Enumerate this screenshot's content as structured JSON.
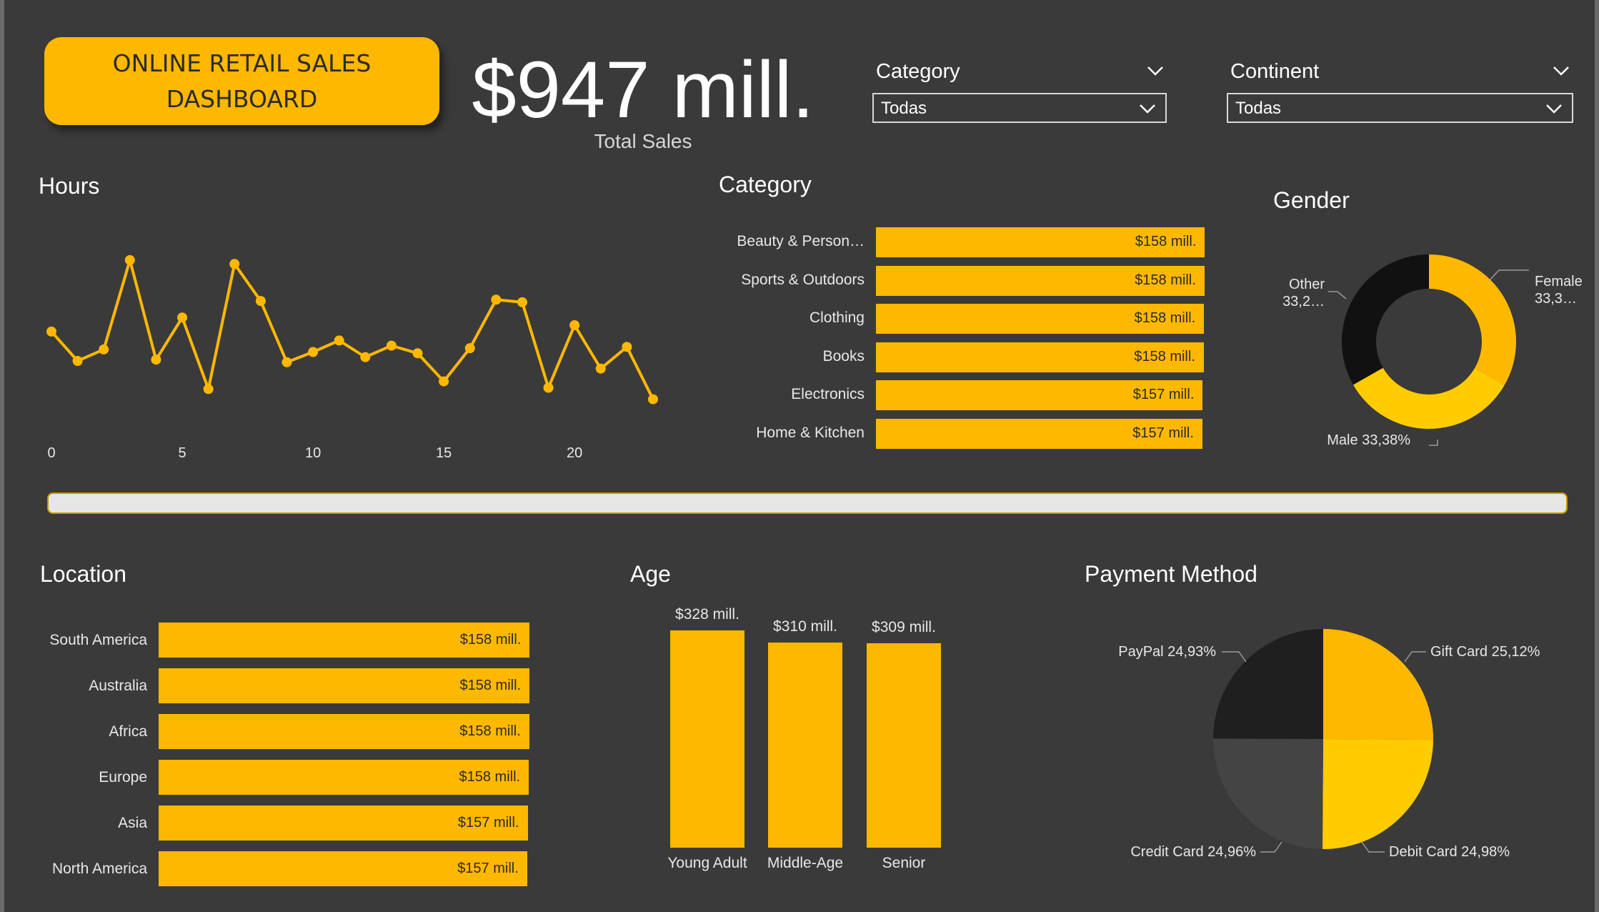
{
  "header": {
    "title": "ONLINE RETAIL SALES\nDASHBOARD",
    "kpi_value": "$947 mill.",
    "kpi_label": "Total Sales"
  },
  "filters": {
    "category": {
      "title": "Category",
      "selected": "Todas"
    },
    "continent": {
      "title": "Continent",
      "selected": "Todas"
    }
  },
  "colors": {
    "background": "#3a3a3a",
    "accent": "#ffb800",
    "accent_light": "#ffcc00",
    "dark_slice": "#1f1f1f",
    "mid_slice": "#444444",
    "scrollbar": "#e6e6e6"
  },
  "icons": {
    "dropdown": "chevron-down-icon"
  },
  "chart_data": [
    {
      "id": "hours",
      "type": "line",
      "title": "Hours",
      "x": [
        0,
        1,
        2,
        3,
        4,
        5,
        6,
        7,
        8,
        9,
        10,
        11,
        12,
        13,
        14,
        15,
        16,
        17,
        18,
        19,
        20,
        21,
        22,
        23
      ],
      "values": [
        41.5,
        39.2,
        40.1,
        47.1,
        39.3,
        42.6,
        37.0,
        46.8,
        43.9,
        39.1,
        39.9,
        40.8,
        39.5,
        40.4,
        39.8,
        37.6,
        40.2,
        44.0,
        43.8,
        37.1,
        42.0,
        38.6,
        40.3,
        36.2
      ],
      "xticks": [
        0,
        5,
        10,
        15,
        20
      ],
      "xlim": [
        0,
        23
      ],
      "ylim": [
        35,
        49
      ],
      "grid": false
    },
    {
      "id": "category",
      "type": "bar",
      "orientation": "horizontal",
      "title": "Category",
      "categories": [
        "Beauty & Person…",
        "Sports & Outdoors",
        "Clothing",
        "Books",
        "Electronics",
        "Home & Kitchen"
      ],
      "values": [
        158.4,
        158.2,
        158.0,
        157.9,
        157.4,
        157.2
      ],
      "labels": [
        "$158 mill.",
        "$158 mill.",
        "$158 mill.",
        "$158 mill.",
        "$157 mill.",
        "$157 mill."
      ],
      "xlim": [
        0,
        160
      ]
    },
    {
      "id": "gender",
      "type": "pie",
      "style": "donut",
      "title": "Gender",
      "slices": [
        {
          "label": "Female",
          "value": 33.3,
          "text": "Female\n33,3…"
        },
        {
          "label": "Male",
          "value": 33.38,
          "text": "Male 33,38%"
        },
        {
          "label": "Other",
          "value": 33.2,
          "text": "Other\n33,2…"
        }
      ]
    },
    {
      "id": "location",
      "type": "bar",
      "orientation": "horizontal",
      "title": "Location",
      "categories": [
        "South America",
        "Australia",
        "Africa",
        "Europe",
        "Asia",
        "North America"
      ],
      "values": [
        158.3,
        158.2,
        158.1,
        157.9,
        157.4,
        157.2
      ],
      "labels": [
        "$158 mill.",
        "$158 mill.",
        "$158 mill.",
        "$158 mill.",
        "$157 mill.",
        "$157 mill."
      ],
      "xlim": [
        0,
        160
      ]
    },
    {
      "id": "age",
      "type": "bar",
      "title": "Age",
      "categories": [
        "Young Adult",
        "Middle-Age",
        "Senior"
      ],
      "values": [
        328,
        310,
        309
      ],
      "labels": [
        "$328 mill.",
        "$310 mill.",
        "$309 mill."
      ],
      "ylim": [
        0,
        328
      ]
    },
    {
      "id": "payment",
      "type": "pie",
      "title": "Payment Method",
      "slices": [
        {
          "label": "Gift Card",
          "value": 25.12,
          "text": "Gift Card 25,12%"
        },
        {
          "label": "Debit Card",
          "value": 24.98,
          "text": "Debit Card 24,98%"
        },
        {
          "label": "Credit Card",
          "value": 24.96,
          "text": "Credit Card 24,96%"
        },
        {
          "label": "PayPal",
          "value": 24.93,
          "text": "PayPal 24,93%"
        }
      ]
    }
  ]
}
